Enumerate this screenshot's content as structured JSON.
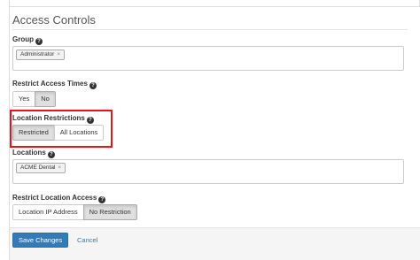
{
  "section": {
    "title": "Access Controls"
  },
  "group": {
    "label": "Group",
    "help_icon": "question-circle-icon",
    "tags": [
      {
        "text": "Administrator",
        "remove": "×"
      }
    ]
  },
  "restrict_access_times": {
    "label": "Restrict Access Times",
    "options": [
      "Yes",
      "No"
    ],
    "selected": "No"
  },
  "location_restrictions": {
    "label": "Location Restrictions",
    "options": [
      "Restricted",
      "All Locations"
    ],
    "selected": "Restricted",
    "highlight_color": "#e0161b"
  },
  "locations": {
    "label": "Locations",
    "tags": [
      {
        "text": "ACME Dental",
        "remove": "×"
      }
    ]
  },
  "restrict_location_access": {
    "label": "Restrict Location Access",
    "options": [
      "Location IP Address",
      "No Restriction"
    ],
    "selected": "No Restriction"
  },
  "footer": {
    "save_label": "Save Changes",
    "cancel_label": "Cancel"
  },
  "colors": {
    "primary": "#337ab7",
    "help_icon": "?"
  }
}
